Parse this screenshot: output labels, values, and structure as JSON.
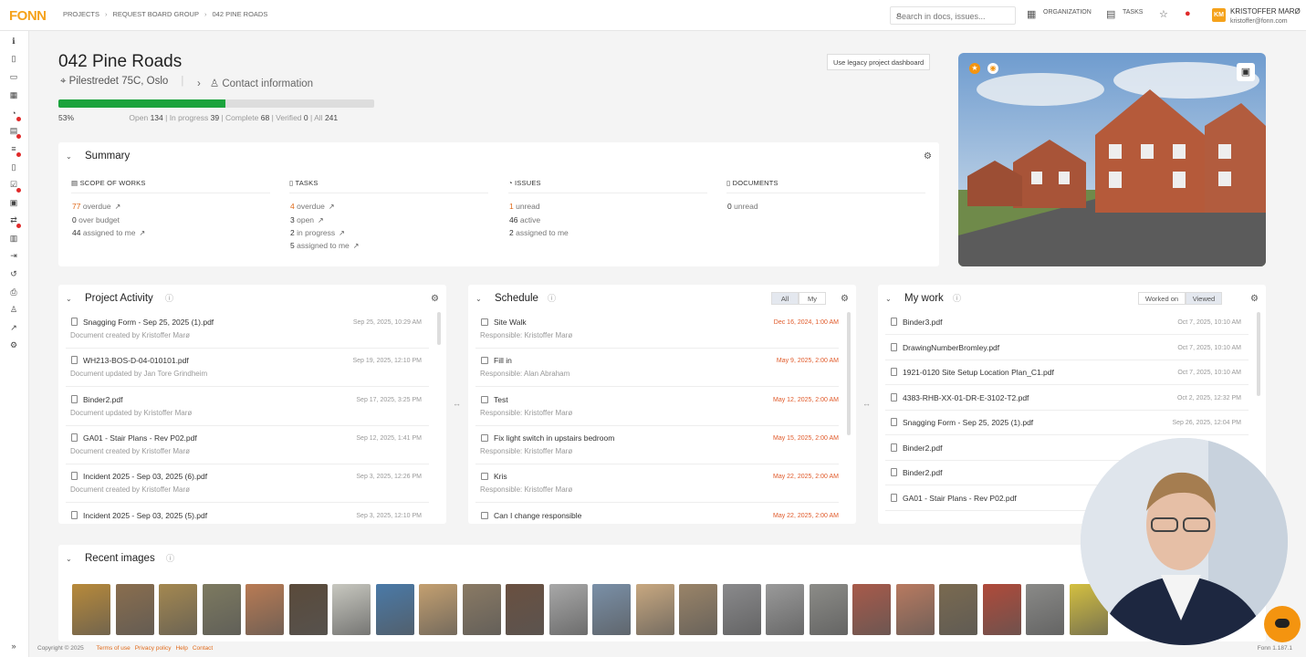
{
  "app": {
    "logo": "FONN"
  },
  "breadcrumb": [
    "PROJECTS",
    "REQUEST BOARD GROUP",
    "042 PINE ROADS"
  ],
  "search": {
    "placeholder": "Search in docs, issues..."
  },
  "topnav": {
    "organization": "ORGANIZATION",
    "tasks": "TASKS"
  },
  "user": {
    "initials": "KM",
    "name": "KRISTOFFER MARØ",
    "email": "kristoffer@fonn.com"
  },
  "project": {
    "title": "042 Pine Roads",
    "address": "Pilestredet 75C, Oslo",
    "contact": "Contact information",
    "legacy_button": "Use legacy project dashboard"
  },
  "progress": {
    "percent_label": "53%",
    "percent": 53,
    "open_label": "Open",
    "open": "134",
    "inprogress_label": "In progress",
    "inprogress": "39",
    "complete_label": "Complete",
    "complete": "68",
    "verified_label": "Verified",
    "verified": "0",
    "all_label": "All",
    "all": "241"
  },
  "summary": {
    "title": "Summary",
    "scope": {
      "header": "SCOPE OF WORKS",
      "overdue_n": "77",
      "overdue": "overdue",
      "budget_n": "0",
      "budget": "over budget",
      "assigned_n": "44",
      "assigned": "assigned to me"
    },
    "tasks": {
      "header": "TASKS",
      "overdue_n": "4",
      "overdue": "overdue",
      "open_n": "3",
      "open": "open",
      "progress_n": "2",
      "progress": "in progress",
      "assigned_n": "5",
      "assigned": "assigned to me"
    },
    "issues": {
      "header": "ISSUES",
      "unread_n": "1",
      "unread": "unread",
      "active_n": "46",
      "active": "active",
      "assigned_n": "2",
      "assigned": "assigned to me"
    },
    "documents": {
      "header": "DOCUMENTS",
      "unread_n": "0",
      "unread": "unread"
    }
  },
  "activity": {
    "title": "Project Activity",
    "items": [
      {
        "t": "Snagging Form - Sep 25, 2025 (1).pdf",
        "s": "Document created by Kristoffer Marø",
        "d": "Sep 25, 2025, 10:29 AM"
      },
      {
        "t": "WH213-BOS-D-04-010101.pdf",
        "s": "Document updated by Jan Tore Grindheim",
        "d": "Sep 19, 2025, 12:10 PM"
      },
      {
        "t": "Binder2.pdf",
        "s": "Document updated by Kristoffer Marø",
        "d": "Sep 17, 2025, 3:25 PM"
      },
      {
        "t": "GA01 - Stair Plans - Rev P02.pdf",
        "s": "Document created by Kristoffer Marø",
        "d": "Sep 12, 2025, 1:41 PM"
      },
      {
        "t": "Incident 2025 - Sep 03, 2025 (6).pdf",
        "s": "Document created by Kristoffer Marø",
        "d": "Sep 3, 2025, 12:26 PM"
      },
      {
        "t": "Incident 2025 - Sep 03, 2025 (5).pdf",
        "s": "",
        "d": "Sep 3, 2025, 12:10 PM"
      }
    ]
  },
  "schedule": {
    "title": "Schedule",
    "tab_all": "All",
    "tab_my": "My",
    "items": [
      {
        "t": "Site Walk",
        "s": "Responsible: Kristoffer Marø",
        "d": "Dec 16, 2024, 1:00 AM"
      },
      {
        "t": "Fill in",
        "s": "Responsible: Alan Abraham",
        "d": "May 9, 2025, 2:00 AM"
      },
      {
        "t": "Test",
        "s": "Responsible: Kristoffer Marø",
        "d": "May 12, 2025, 2:00 AM"
      },
      {
        "t": "Fix light switch in upstairs bedroom",
        "s": "Responsible: Kristoffer Marø",
        "d": "May 15, 2025, 2:00 AM"
      },
      {
        "t": "Kris",
        "s": "Responsible: Kristoffer Marø",
        "d": "May 22, 2025, 2:00 AM"
      },
      {
        "t": "Can I change responsible",
        "s": "",
        "d": "May 22, 2025, 2:00 AM"
      }
    ]
  },
  "mywork": {
    "title": "My work",
    "tab_worked": "Worked on",
    "tab_viewed": "Viewed",
    "items": [
      {
        "t": "Binder3.pdf",
        "d": "Oct 7, 2025, 10:10 AM"
      },
      {
        "t": "DrawingNumberBromley.pdf",
        "d": "Oct 7, 2025, 10:10 AM"
      },
      {
        "t": "1921-0120 Site Setup Location Plan_C1.pdf",
        "d": "Oct 7, 2025, 10:10 AM"
      },
      {
        "t": "4383-RHB-XX-01-DR-E-3102-T2.pdf",
        "d": "Oct 2, 2025, 12:32 PM"
      },
      {
        "t": "Snagging Form - Sep 25, 2025 (1).pdf",
        "d": "Sep 26, 2025, 12:04 PM"
      },
      {
        "t": "Binder2.pdf",
        "d": ""
      },
      {
        "t": "Binder2.pdf",
        "d": ""
      },
      {
        "t": "GA01 - Stair Plans - Rev P02.pdf",
        "d": ""
      }
    ]
  },
  "recent_images": {
    "title": "Recent images",
    "colors": [
      "#b88a3a",
      "#8a6e4e",
      "#a48850",
      "#7d7a60",
      "#b97b54",
      "#5a4a3a",
      "#c8c8c0",
      "#4a7aa8",
      "#c4a070",
      "#8a7a64",
      "#6a5040",
      "#a8a8a8",
      "#7a90a8",
      "#c8a880",
      "#9a8468",
      "#8a8a8c",
      "#9a9a9a",
      "#8c8c88",
      "#a85a4a",
      "#b87a60",
      "#7a6a50",
      "#b04a3a",
      "#8a8a88",
      "#d4c040"
    ]
  },
  "footer": {
    "copyright": "Copyright © 2025",
    "terms": "Terms of use",
    "privacy": "Privacy policy",
    "help": "Help",
    "contact": "Contact",
    "version": "Fonn 1.187.1"
  }
}
